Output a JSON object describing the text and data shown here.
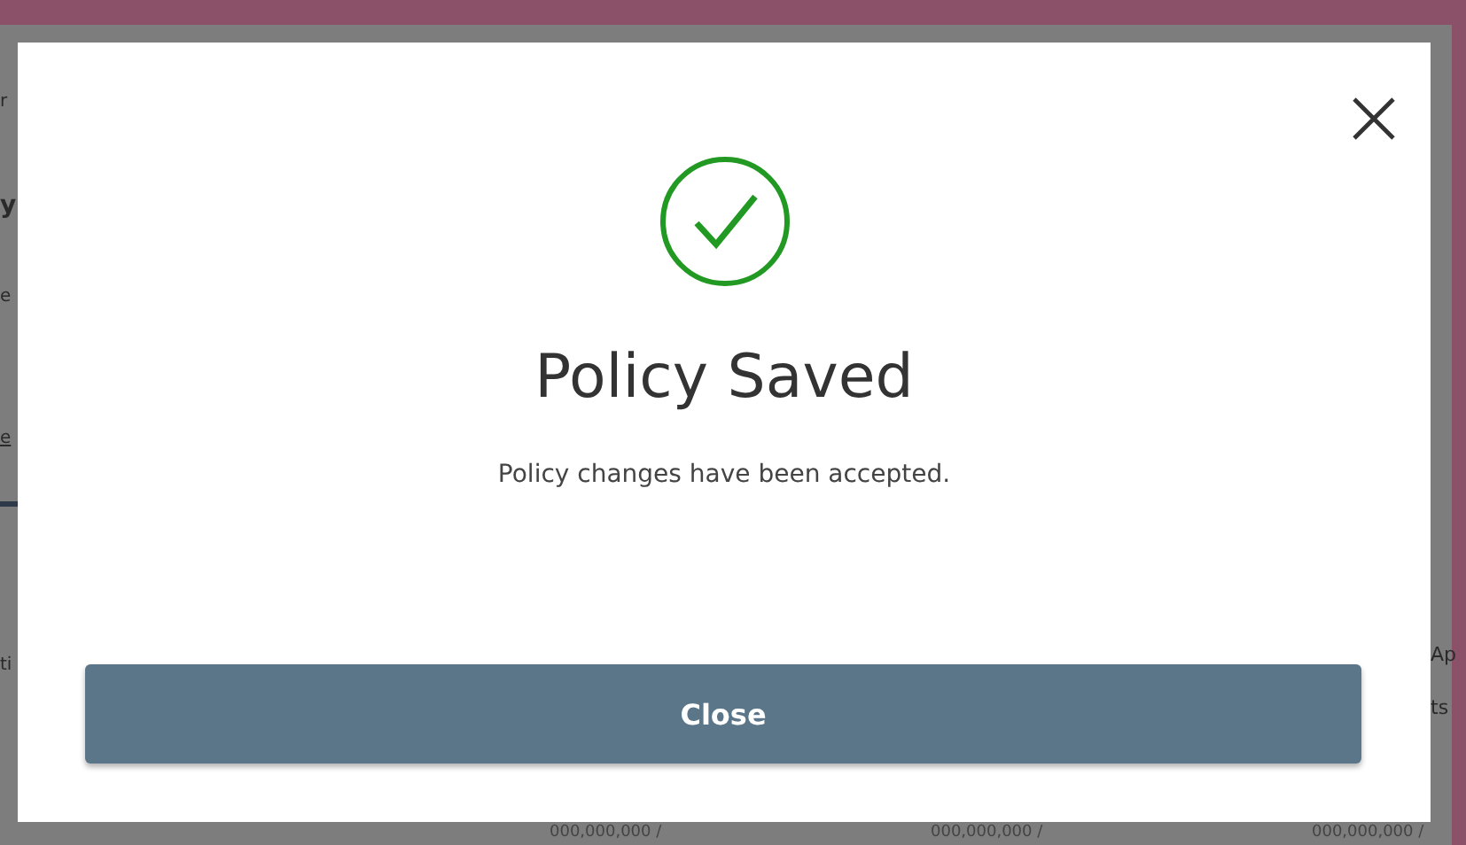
{
  "backdrop": {
    "left_fragments": [
      {
        "text": "r",
        "kind": "text"
      },
      {
        "text": "y",
        "kind": "heading"
      },
      {
        "text": "e",
        "kind": "text"
      },
      {
        "text": "e",
        "kind": "link"
      },
      {
        "text": "ti",
        "kind": "text"
      }
    ],
    "right_fragments": [
      "Ap",
      "ts"
    ],
    "bottom_fragments": [
      "000,000,000 /",
      "000,000,000 /",
      "000,000,000 /"
    ]
  },
  "dialog": {
    "title": "Policy Saved",
    "message": "Policy changes have been accepted.",
    "button": "Close"
  }
}
